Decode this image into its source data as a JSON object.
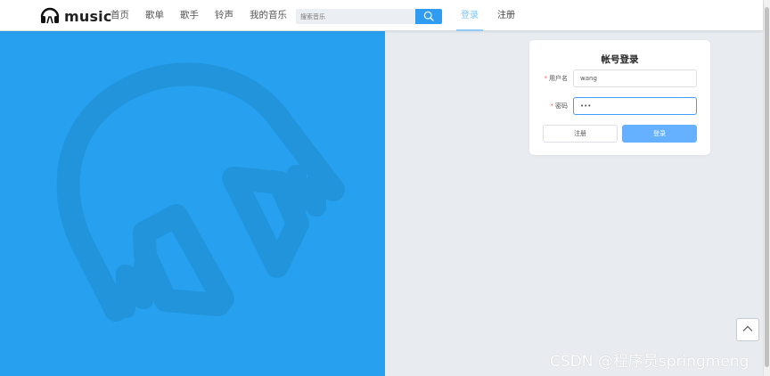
{
  "brand": {
    "name": "music",
    "logo_icon": "headphones-icon"
  },
  "nav": {
    "items": [
      "首页",
      "歌单",
      "歌手",
      "铃声",
      "我的音乐"
    ]
  },
  "search": {
    "placeholder": "搜索音乐",
    "icon": "search-icon",
    "button_color": "#2f9cf1"
  },
  "auth": {
    "login": "登录",
    "register": "注册",
    "active": "登录"
  },
  "hero": {
    "background_color": "#27a1ef",
    "icon": "headphones-icon"
  },
  "login_form": {
    "title": "帐号登录",
    "username_label": "用户名",
    "username_value": "wang",
    "password_label": "密码",
    "password_value": "•••",
    "required_mark": "*",
    "register_button": "注册",
    "login_button": "登录",
    "login_button_color": "#66b1ff"
  },
  "back_to_top": {
    "icon": "chevron-up-icon"
  },
  "watermark": {
    "text": "CSDN @程序员springmeng"
  }
}
